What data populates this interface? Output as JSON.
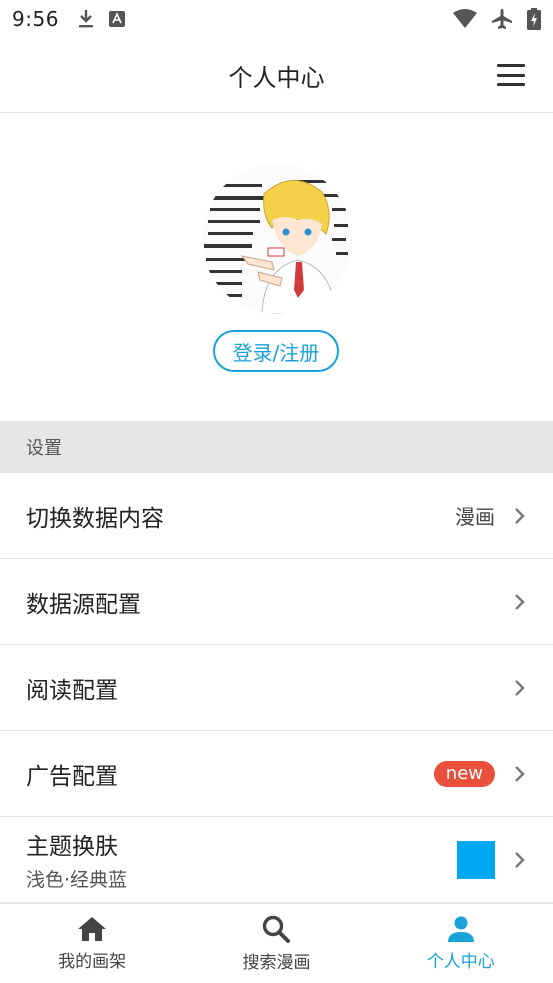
{
  "status_bar": {
    "time": "9:56"
  },
  "header": {
    "title": "个人中心"
  },
  "profile": {
    "login_label": "登录/注册"
  },
  "settings": {
    "section_title": "设置",
    "items": [
      {
        "label": "切换数据内容",
        "value": "漫画"
      },
      {
        "label": "数据源配置"
      },
      {
        "label": "阅读配置"
      },
      {
        "label": "广告配置",
        "badge": "new"
      },
      {
        "label": "主题换肤",
        "sub": "浅色·经典蓝",
        "swatch_color": "#00a8f3"
      }
    ]
  },
  "bottom_nav": {
    "items": [
      {
        "label": "我的画架",
        "icon": "home-icon"
      },
      {
        "label": "搜索漫画",
        "icon": "search-icon"
      },
      {
        "label": "个人中心",
        "icon": "person-icon",
        "active": true
      }
    ]
  },
  "colors": {
    "accent": "#1aa3d8",
    "badge": "#e8503c",
    "section_bg": "#e6e6e6"
  }
}
